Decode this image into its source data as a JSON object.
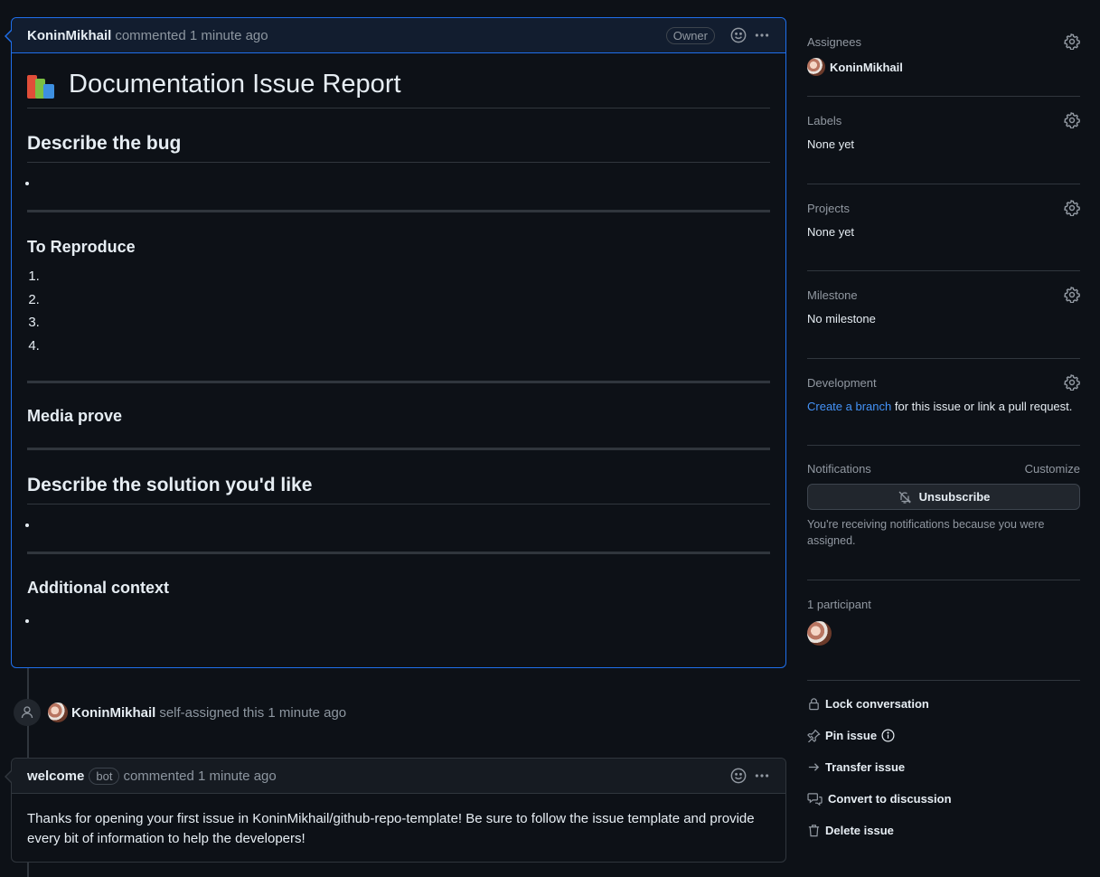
{
  "main_comment": {
    "author": "KoninMikhail",
    "action_text": "commented 1 minute ago",
    "role_badge": "Owner",
    "title": "Documentation Issue Report",
    "sections": {
      "describe_bug": "Describe the bug",
      "to_reproduce": "To Reproduce",
      "reproduce_steps": [
        "",
        "",
        "",
        ""
      ],
      "media_prove": "Media prove",
      "describe_solution": "Describe the solution you'd like",
      "additional_context": "Additional context"
    }
  },
  "event": {
    "author": "KoninMikhail",
    "text": "self-assigned this 1 minute ago"
  },
  "bot_comment": {
    "author": "welcome",
    "badge": "bot",
    "action_text": "commented 1 minute ago",
    "body": "Thanks for opening your first issue in KoninMikhail/github-repo-template! Be sure to follow the issue template and provide every bit of information to help the developers!"
  },
  "sidebar": {
    "assignees": {
      "title": "Assignees",
      "value": "KoninMikhail"
    },
    "labels": {
      "title": "Labels",
      "value": "None yet"
    },
    "projects": {
      "title": "Projects",
      "value": "None yet"
    },
    "milestone": {
      "title": "Milestone",
      "value": "No milestone"
    },
    "development": {
      "title": "Development",
      "link_text": "Create a branch",
      "rest_text": " for this issue or link a pull request."
    },
    "notifications": {
      "title": "Notifications",
      "customize": "Customize",
      "button": "Unsubscribe",
      "reason": "You're receiving notifications because you were assigned."
    },
    "participants": {
      "title": "1 participant"
    },
    "actions": {
      "lock": "Lock conversation",
      "pin": "Pin issue",
      "transfer": "Transfer issue",
      "convert": "Convert to discussion",
      "delete": "Delete issue"
    }
  },
  "colors": {
    "background": "#0d1117",
    "border": "#30363d",
    "accent_border": "#1f6feb",
    "link": "#4493f8",
    "muted": "#8d96a0"
  }
}
